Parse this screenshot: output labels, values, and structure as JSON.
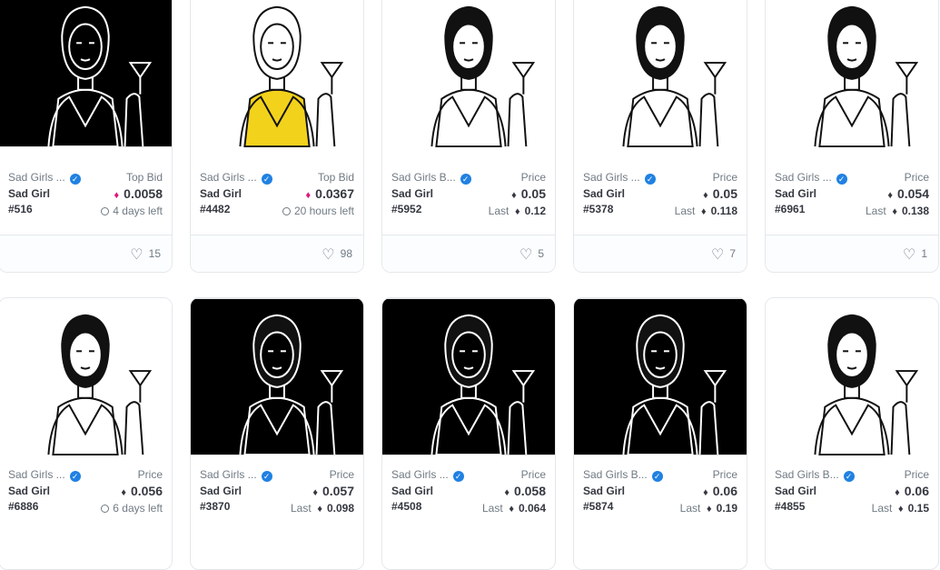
{
  "cards": [
    {
      "collection": "Sad Girls ...",
      "name": "Sad Girl #516",
      "label": "Top Bid",
      "price": "0.0058",
      "currency": "WETH",
      "sub_time": "4 days left",
      "likes": "15",
      "bg": "#000000"
    },
    {
      "collection": "Sad Girls ...",
      "name": "Sad Girl #4482",
      "label": "Top Bid",
      "price": "0.0367",
      "currency": "WETH",
      "sub_time": "20 hours left",
      "likes": "98",
      "bg": "#ffffff"
    },
    {
      "collection": "Sad Girls B...",
      "name": "Sad Girl #5952",
      "label": "Price",
      "price": "0.05",
      "currency": "ETH",
      "sub_last_label": "Last",
      "sub_last": "0.12",
      "likes": "5",
      "bg": "#ffffff"
    },
    {
      "collection": "Sad Girls ...",
      "name": "Sad Girl #5378",
      "label": "Price",
      "price": "0.05",
      "currency": "ETH",
      "sub_last_label": "Last",
      "sub_last": "0.118",
      "likes": "7",
      "bg": "#ffffff"
    },
    {
      "collection": "Sad Girls ...",
      "name": "Sad Girl #6961",
      "label": "Price",
      "price": "0.054",
      "currency": "ETH",
      "sub_last_label": "Last",
      "sub_last": "0.138",
      "likes": "1",
      "bg": "#ffffff"
    },
    {
      "collection": "Sad Girls ...",
      "name": "Sad Girl #6886",
      "label": "Price",
      "price": "0.056",
      "currency": "ETH",
      "sub_time": "6 days left",
      "bg": "#ffffff"
    },
    {
      "collection": "Sad Girls ...",
      "name": "Sad Girl #3870",
      "label": "Price",
      "price": "0.057",
      "currency": "ETH",
      "sub_last_label": "Last",
      "sub_last": "0.098",
      "bg": "#000000"
    },
    {
      "collection": "Sad Girls ...",
      "name": "Sad Girl #4508",
      "label": "Price",
      "price": "0.058",
      "currency": "ETH",
      "sub_last_label": "Last",
      "sub_last": "0.064",
      "bg": "#000000"
    },
    {
      "collection": "Sad Girls B...",
      "name": "Sad Girl #5874",
      "label": "Price",
      "price": "0.06",
      "currency": "ETH",
      "sub_last_label": "Last",
      "sub_last": "0.19",
      "bg": "#000000"
    },
    {
      "collection": "Sad Girls B...",
      "name": "Sad Girl #4855",
      "label": "Price",
      "price": "0.06",
      "currency": "ETH",
      "sub_last_label": "Last",
      "sub_last": "0.15",
      "bg": "#ffffff"
    }
  ],
  "icons": {
    "verified": "verified-badge-icon",
    "eth": "ethereum-icon",
    "weth": "weth-icon",
    "clock": "clock-icon",
    "heart": "heart-icon"
  },
  "colors": {
    "verified": "#2081e2",
    "weth": "#e0137a",
    "border": "#e5e8eb",
    "muted": "#707a83"
  }
}
